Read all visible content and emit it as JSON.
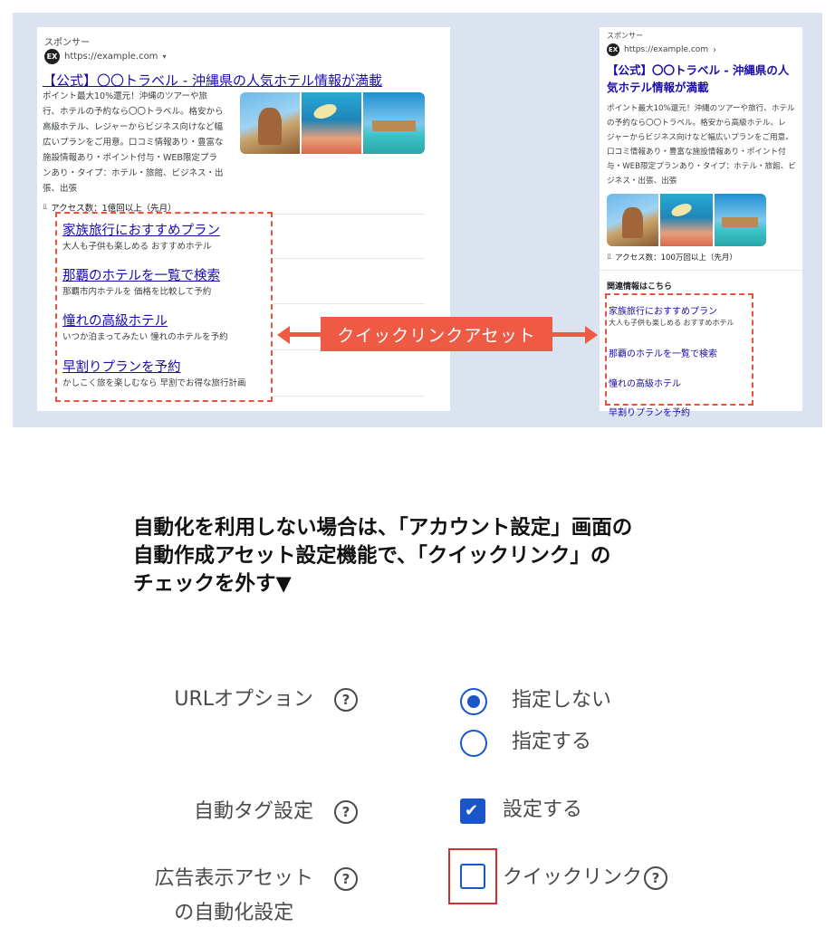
{
  "illustration": {
    "left_ad": {
      "sponsor": "スポンサー",
      "badge": "EX",
      "url": "https://example.com",
      "url_caret": "▾",
      "title": "【公式】〇〇トラベル - 沖縄県の人気ホテル情報が満載",
      "desc_lines": [
        "ポイント最大10%還元！沖縄のツアーや旅",
        "行、ホテルの予約なら〇〇トラベル。格安から",
        "高級ホテル、レジャーからビジネス向けなど幅",
        "広いプランをご用意。口コミ情報あり・豊富な",
        "施設情報あり・ポイント付与・WEB限定プラ",
        "ンあり・タイプ：ホテル・旅館、ビジネス・出",
        "張、出張"
      ],
      "stat_icon": "⫫",
      "stat": "アクセス数：1億回以上（先月）",
      "quicklinks": [
        {
          "title": "家族旅行におすすめプラン",
          "desc": "大人も子供も楽しめる おすすめホテル"
        },
        {
          "title": "那覇のホテルを一覧で検索",
          "desc": "那覇市内ホテルを 価格を比較して予約"
        },
        {
          "title": "憧れの高級ホテル",
          "desc": "いつか泊まってみたい 憧れのホテルを予約"
        },
        {
          "title": "早割りプランを予約",
          "desc": "かしこく旅を楽しむなら 早割でお得な旅行計画"
        }
      ]
    },
    "right_ad": {
      "sponsor": "スポンサー",
      "badge": "EX",
      "url": "https://example.com",
      "url_caret": "›",
      "title_lines": [
        "【公式】〇〇トラベル - 沖縄県の人",
        "気ホテル情報が満載"
      ],
      "desc_lines": [
        "ポイント最大10%還元！沖縄のツアーや旅行、ホテル",
        "の予約なら〇〇トラベル。格安から高級ホテル、レ",
        "ジャーからビジネス向けなど幅広いプランをご用意。",
        "口コミ情報あり・豊富な施設情報あり・ポイント付",
        "与・WEB限定プランあり・タイプ：ホテル・旅館、ビ",
        "ジネス・出張、出張"
      ],
      "stat_icon": "⫫",
      "stat": "アクセス数：100万回以上（先月）",
      "related_heading": "関連情報はこちら",
      "quicklinks": [
        "家族旅行におすすめプラン",
        "那覇のホテルを一覧で検索",
        "憧れの高級ホテル",
        "早割りプランを予約"
      ]
    },
    "callout": "クイックリンクアセット"
  },
  "heading_lines": [
    "自動化を利用しない場合は、「アカウント設定」画面の",
    "自動作成アセット設定機能で、「クイックリンク」の",
    "チェックを外す▼"
  ],
  "settings": {
    "help_glyph": "?",
    "url_option": {
      "label": "URLオプション",
      "options": [
        {
          "label": "指定しない",
          "selected": true
        },
        {
          "label": "指定する",
          "selected": false
        }
      ]
    },
    "auto_tag": {
      "label": "自動タグ設定",
      "checkbox_label": "設定する",
      "checked": true,
      "check_glyph": "✔"
    },
    "asset_automation": {
      "label_lines": [
        "広告表示アセット",
        "の自動化設定"
      ],
      "checkbox_label": "クイックリンク",
      "checked": false
    }
  },
  "colors": {
    "panel_bg": "#dae3ef",
    "accent_red": "#ee5a43",
    "link_blue": "#1a0dab",
    "control_blue": "#1a56c8",
    "highlight_red": "#d0302f"
  }
}
